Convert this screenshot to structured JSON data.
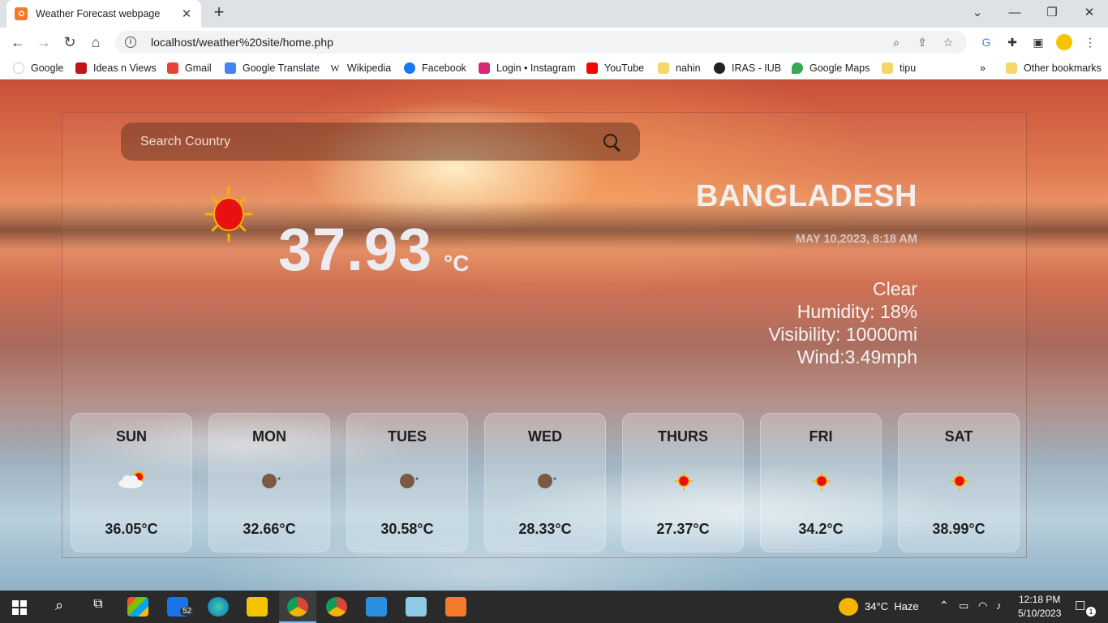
{
  "browser": {
    "tab_title": "Weather Forecast webpage",
    "url": "localhost/weather%20site/home.php",
    "bookmarks": [
      "Google",
      "Ideas n Views",
      "Gmail",
      "Google Translate",
      "Wikipedia",
      "Facebook",
      "Login • Instagram",
      "YouTube",
      "nahin",
      "IRAS - IUB",
      "Google Maps",
      "tipu"
    ],
    "overflow": "»",
    "other_bookmarks": "Other bookmarks"
  },
  "search": {
    "placeholder": "Search Country"
  },
  "current": {
    "temp": "37.93",
    "unit": "°C",
    "country": "BANGLADESH",
    "datetime": "MAY 10,2023, 8:18 AM",
    "condition": "Clear",
    "humidity": "Humidity: 18%",
    "visibility": "Visibility: 10000mi",
    "wind": "Wind:3.49mph",
    "icon": "sun-icon"
  },
  "forecast": [
    {
      "day": "SUN",
      "temp": "36.05°C",
      "icon": "partly-cloudy-icon"
    },
    {
      "day": "MON",
      "temp": "32.66°C",
      "icon": "moon-icon"
    },
    {
      "day": "TUES",
      "temp": "30.58°C",
      "icon": "moon-icon"
    },
    {
      "day": "WED",
      "temp": "28.33°C",
      "icon": "moon-icon"
    },
    {
      "day": "THURS",
      "temp": "27.37°C",
      "icon": "sun-icon"
    },
    {
      "day": "FRI",
      "temp": "34.2°C",
      "icon": "sun-icon"
    },
    {
      "day": "SAT",
      "temp": "38.99°C",
      "icon": "sun-icon"
    }
  ],
  "taskbar": {
    "mail_badge": "52",
    "weather": "34°C  Haze",
    "time": "12:18 PM",
    "date": "5/10/2023",
    "notification_count": "1"
  }
}
